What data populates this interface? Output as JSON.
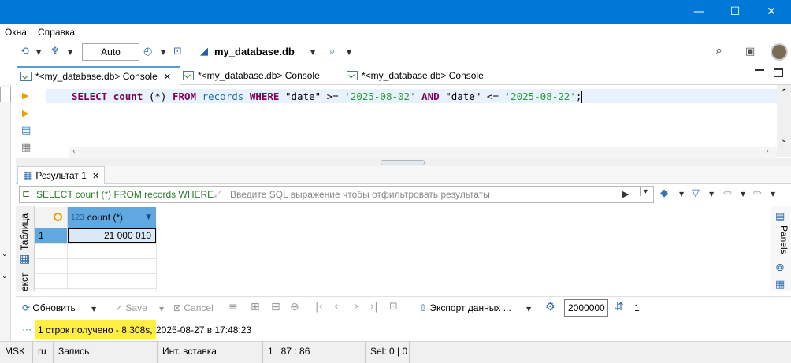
{
  "window": {
    "minimize": "—",
    "maximize": "☐",
    "close": "✕"
  },
  "menu": {
    "items": [
      "Окна",
      "Справка"
    ]
  },
  "toolbar": {
    "mode": "Auto",
    "database": "my_database.db"
  },
  "tabs": [
    {
      "label": "*<my_database.db> Console",
      "active": true,
      "close": "✕"
    },
    {
      "label": "*<my_database.db> Console",
      "active": false
    },
    {
      "label": "*<my_database.db> Console",
      "active": false
    }
  ],
  "editor": {
    "sql": {
      "kw1": "SELECT",
      "fn": "count",
      "star": "(*)",
      "kw2": "FROM",
      "table": "records",
      "kw3": "WHERE",
      "col1": "\"date\"",
      "op1": ">=",
      "val1": "'2025-08-02'",
      "kw4": "AND",
      "col2": "\"date\"",
      "op2": "<=",
      "val2": "'2025-08-22'",
      "end": ";"
    }
  },
  "results": {
    "tab_label": "Результат 1",
    "filter_sql": "SELECT count (*) FROM records WHERE",
    "filter_placeholder": "Введите SQL выражение чтобы отфильтровать результаты",
    "side_tab_table": "Таблица",
    "side_tab_text": "екст",
    "panels_label": "Panels",
    "column_type": "123",
    "column_name": "count (*)",
    "rows": [
      {
        "num": "1",
        "value": "21 000 010"
      }
    ]
  },
  "bottom": {
    "refresh": "Обновить",
    "save": "Save",
    "cancel": "Cancel",
    "export": "Экспорт данных ...",
    "fetch_size": "2000000",
    "page": "1"
  },
  "status": {
    "dots": "···",
    "highlight": "1 строк получено - 8.308s,",
    "rest": "2025-08-27 в 17:48:23"
  },
  "statusbar": {
    "tz": "MSK",
    "lang": "ru",
    "mode": "Запись",
    "insert": "Инт. вставка",
    "pos": "1 : 87 : 86",
    "sel": "Sel: 0 | 0"
  },
  "colors": {
    "titlebar": "#0078d7",
    "selected_header": "#5fa8e0",
    "highlight": "#ffef44"
  }
}
